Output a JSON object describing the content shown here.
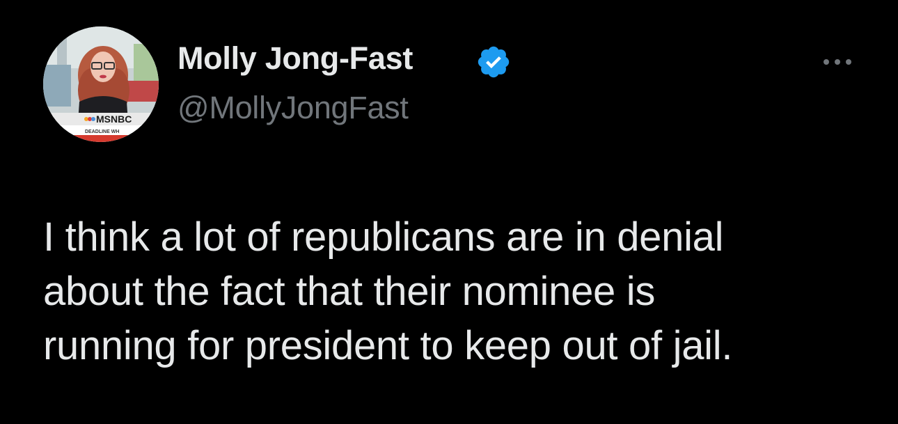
{
  "author": {
    "display_name": "Molly Jong-Fast",
    "handle": "@MollyJongFast",
    "verified": true,
    "avatar_caption": "MSNBC",
    "avatar_ticker": "DEADLINE WH"
  },
  "tweet": {
    "lines": [
      "I think a lot of republicans are in denial",
      "about the fact that their nominee is",
      "running for president to keep out of jail."
    ]
  },
  "icons": {
    "verified": "verified-badge-icon",
    "more": "more-horizontal-icon"
  },
  "colors": {
    "background": "#000000",
    "text_primary": "#e7e9ea",
    "text_secondary": "#71767b",
    "verified_blue": "#1d9bf0"
  }
}
